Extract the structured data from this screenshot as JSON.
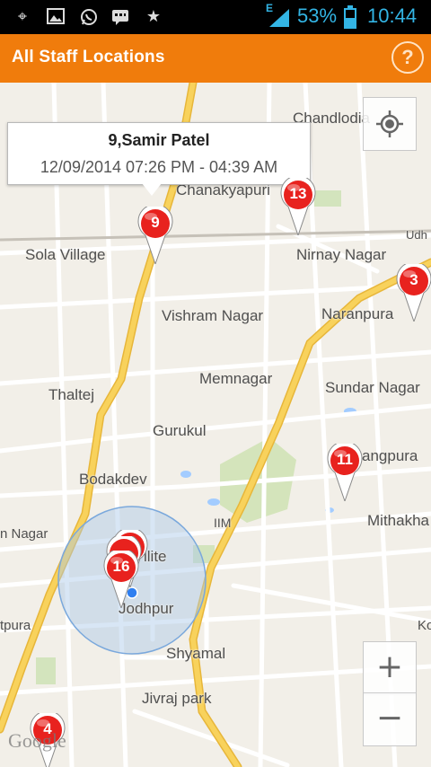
{
  "status_bar": {
    "icons": [
      "gps-icon",
      "gallery-icon",
      "whatsapp-icon",
      "bbm-icon",
      "star-icon"
    ],
    "network": "E",
    "battery": "53%",
    "time": "10:44"
  },
  "action_bar": {
    "title": "All Staff Locations",
    "help_label": "?"
  },
  "info_window": {
    "title": "9,Samir Patel",
    "subtitle": "12/09/2014 07:26 PM - 04:39 AM"
  },
  "places": {
    "chandlodia": "Chandlodia",
    "chanakyapuri": "Chanakyapuri",
    "sola_village": "Sola Village",
    "nirnay_nagar": "Nirnay Nagar",
    "naranpura": "Naranpura",
    "vishram_nagar": "Vishram Nagar",
    "memnagar": "Memnagar",
    "thaltej": "Thaltej",
    "sundar_nagar": "Sundar Nagar",
    "gurukul": "Gurukul",
    "bodakdev": "Bodakdev",
    "navrangpura": "angpura",
    "mithakhali": "Mithakha",
    "iim": "IIM",
    "satellite": "llite",
    "nagar_left": "n Nagar",
    "jodhpur": "Jodhpur",
    "shyamal": "Shyamal",
    "jivraj_park": "Jivraj park",
    "vastrapur_left": "tpura",
    "kocharab": "Ko",
    "udh": "Udh",
    "google": "Google"
  },
  "markers": [
    {
      "label": "9"
    },
    {
      "label": "13"
    },
    {
      "label": "3"
    },
    {
      "label": "11"
    },
    {
      "label": "16"
    },
    {
      "label": "4"
    }
  ],
  "controls": {
    "zoom_in": "+",
    "zoom_out": "−"
  },
  "colors": {
    "action_bar": "#f07c0c",
    "marker_red": "#e8221e",
    "highway": "#f6c445",
    "accuracy_circle": "#a9c7e8",
    "status_accent": "#33b5e5"
  }
}
